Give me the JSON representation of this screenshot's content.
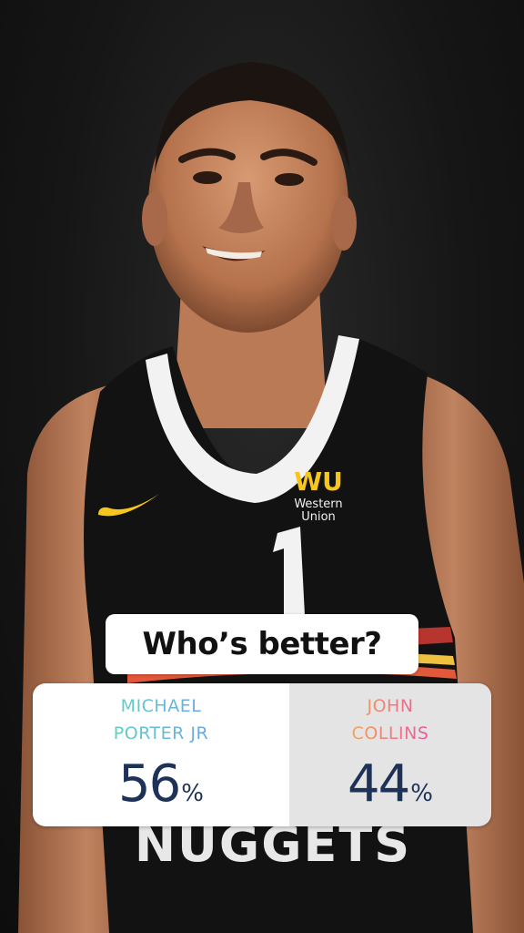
{
  "story": {
    "photo_subject": "basketball-player-photo",
    "jersey_sponsor_logo": "WU",
    "jersey_sponsor_name": "Western Union",
    "jersey_number": "1",
    "jersey_team_text": "NUGGETS"
  },
  "poll": {
    "question": "Who’s better?",
    "options": [
      {
        "label": "MICHAEL PORTER JR",
        "percent": "56",
        "percent_sign": "%",
        "share": 0.56
      },
      {
        "label": "JOHN COLLINS",
        "percent": "44",
        "percent_sign": "%",
        "share": 0.44
      }
    ]
  },
  "colors": {
    "option_a_gradient": [
      "#5fd0c2",
      "#6aa6e8"
    ],
    "option_b_gradient": [
      "#f5a15a",
      "#e95aa0"
    ],
    "percent_text": "#1e3257",
    "jersey": "#121212",
    "nike_swoosh": "#f7c61d"
  }
}
